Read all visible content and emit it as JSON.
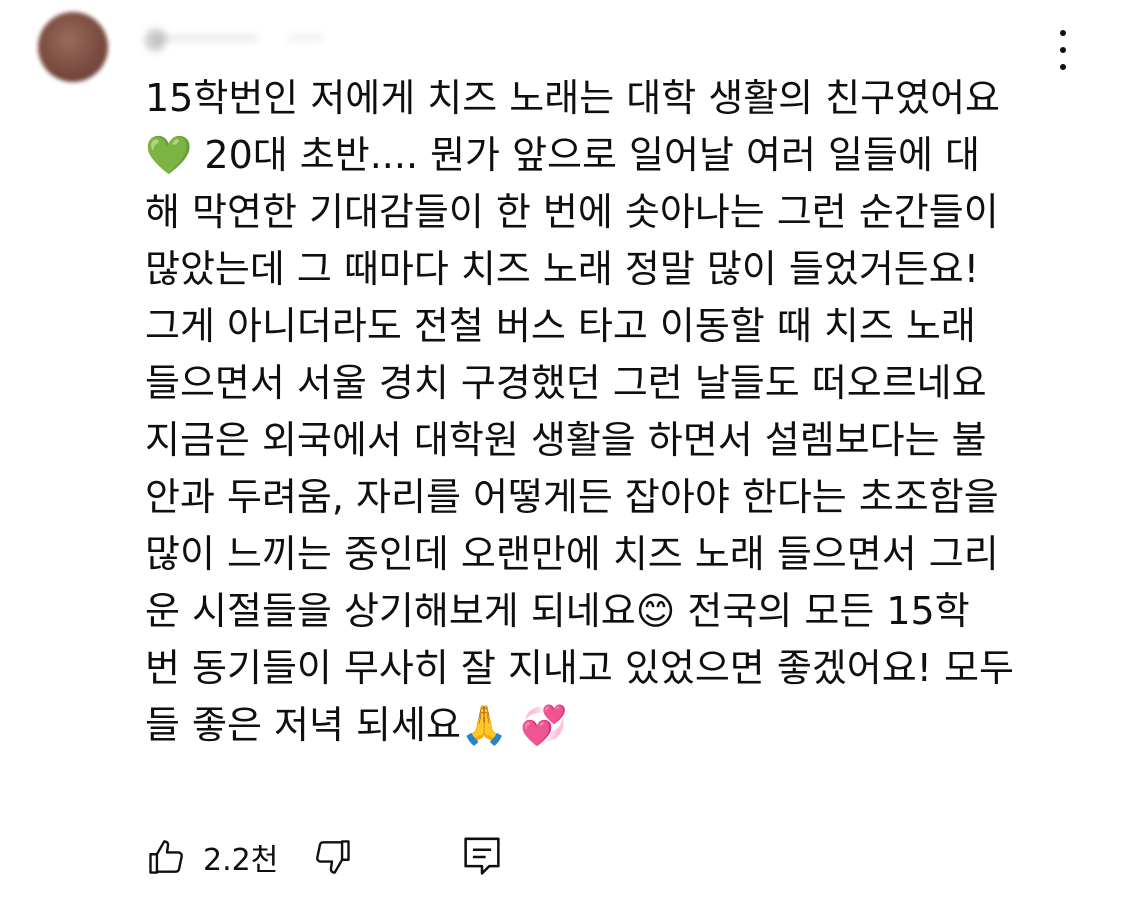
{
  "comment": {
    "lines": [
      "15학번인 저에게 치즈 노래는 대학 생활의 친구였어요",
      "💚 20대 초반.... 뭔가 앞으로 일어날 여러 일들에 대",
      "해 막연한 기대감들이 한 번에 솟아나는 그런 순간들이",
      "많았는데 그 때마다 치즈 노래 정말 많이 들었거든요!",
      "그게 아니더라도 전철 버스 타고 이동할 때 치즈 노래",
      "들으면서 서울 경치 구경했던 그런 날들도 떠오르네요",
      "지금은 외국에서 대학원 생활을 하면서 설렘보다는 불",
      "안과 두려움, 자리를 어떻게든 잡아야 한다는 초조함을",
      "많이 느끼는 중인데 오랜만에 치즈 노래 들으면서 그리",
      "운 시절들을 상기해보게 되네요😊 전국의 모든 15학",
      "번 동기들이 무사히 잘 지내고 있었으면 좋겠어요! 모두",
      "들 좋은 저녁 되세요🙏 💞"
    ]
  },
  "actions": {
    "like_count": "2.2천"
  },
  "icons": {
    "avatar": "avatar",
    "more": "more-vert-icon",
    "like": "thumbs-up-icon",
    "dislike": "thumbs-down-icon",
    "reply": "reply-comment-icon"
  }
}
